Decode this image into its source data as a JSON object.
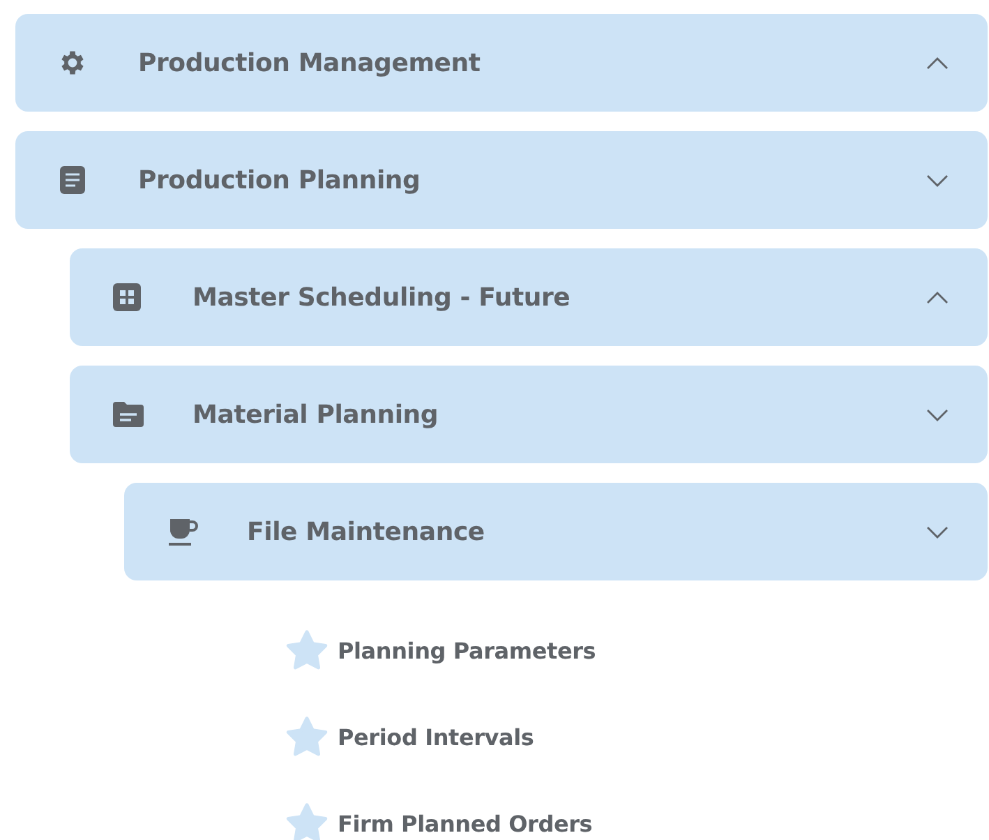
{
  "menu": [
    {
      "label": "Production Management",
      "kind": "group",
      "expanded": true
    },
    {
      "label": "Production Planning",
      "kind": "group",
      "expanded": false,
      "children": [
        {
          "label": "Master Scheduling - Future",
          "kind": "group",
          "expanded": true
        },
        {
          "label": "Material Planning",
          "kind": "group",
          "expanded": false,
          "children": [
            {
              "label": "File Maintenance",
              "kind": "group",
              "expanded": false,
              "children": [
                {
                  "label": "Planning Parameters",
                  "kind": "leaf"
                },
                {
                  "label": "Period Intervals",
                  "kind": "leaf"
                },
                {
                  "label": "Firm Planned Orders",
                  "kind": "leaf"
                }
              ]
            }
          ]
        }
      ]
    }
  ]
}
